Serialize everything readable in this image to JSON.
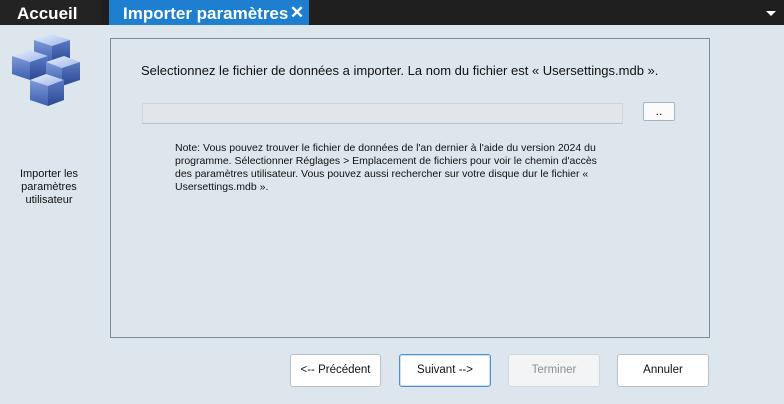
{
  "tabs": {
    "home_label": "Accueil",
    "active_label": "Importer paramètres",
    "close_glyph": "✕",
    "close_icon": "close-icon",
    "menu_icon": "chevron-down-icon",
    "active_color": "#1e7fd0"
  },
  "step": {
    "icon": "cubes-icon",
    "label": "Importer les paramètres utilisateur"
  },
  "panel": {
    "instruction": "Selectionnez le fichier de données a importer. La nom du fichier est « Usersettings.mdb ».",
    "file_path_value": "",
    "browse_label": "..",
    "note": "Note: Vous pouvez trouver le fichier de données de l'an dernier à l'aide du version 2024 du programme. Sélectionner Réglages > Emplacement de fichiers pour voir le chemin d'accès des paramètres utilisateur. Vous pouvez aussi rechercher sur votre disque dur le fichier « Usersettings.mdb »."
  },
  "buttons": {
    "previous": "<-- Précédent",
    "next": "Suivant -->",
    "finish": "Terminer",
    "cancel": "Annuler"
  }
}
